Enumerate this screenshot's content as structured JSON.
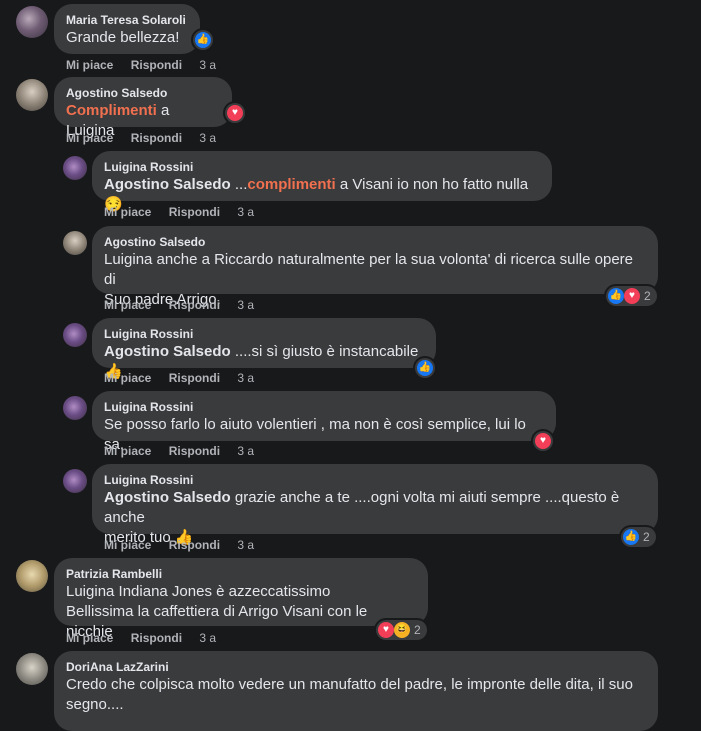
{
  "actions": {
    "like": "Mi piace",
    "reply": "Rispondi"
  },
  "comments": [
    {
      "author": "Maria Teresa Solaroli",
      "text": "Grande bellezza!",
      "time": "3 a"
    },
    {
      "author": "Agostino Salsedo",
      "highlight": "Complimenti",
      "text": " a Luigina",
      "time": "3 a"
    },
    {
      "author": "Luigina Rossini",
      "mention": "Agostino Salsedo",
      "pre": " ...",
      "highlight": "complimenti",
      "text": " a Visani io non ho fatto nulla",
      "emoji": "😏",
      "time": "3 a"
    },
    {
      "author": "Agostino Salsedo",
      "line1": "Luigina anche a Riccardo naturalmente per la sua volonta' di ricerca sulle opere di",
      "line2": "Suo padre Arrigo.",
      "time": "3 a",
      "reactions_count": "2"
    },
    {
      "author": "Luigina Rossini",
      "mention": "Agostino Salsedo",
      "text": " ....si sì giusto è instancabile",
      "time": "3 a"
    },
    {
      "author": "Luigina Rossini",
      "text": "Se posso farlo lo aiuto volentieri , ma non è così semplice, lui lo sa.",
      "time": "3 a"
    },
    {
      "author": "Luigina Rossini",
      "mention": "Agostino Salsedo",
      "line1": " grazie anche a te ....ogni volta mi aiuti sempre ....questo è anche",
      "line2": "merito tuo",
      "time": "3 a",
      "reactions_count": "2"
    },
    {
      "author": "Patrizia Rambelli",
      "line1": "Luigina Indiana Jones è azzeccatissimo",
      "line2": "Bellissima la caffettiera di Arrigo Visani con le nicchie",
      "time": "3 a",
      "reactions_count": "2"
    },
    {
      "author": "DoriAna LazZarini",
      "line1": "Credo che colpisca molto vedere un manufatto del padre, le impronte delle dita, il suo",
      "line2": "segno...."
    }
  ]
}
